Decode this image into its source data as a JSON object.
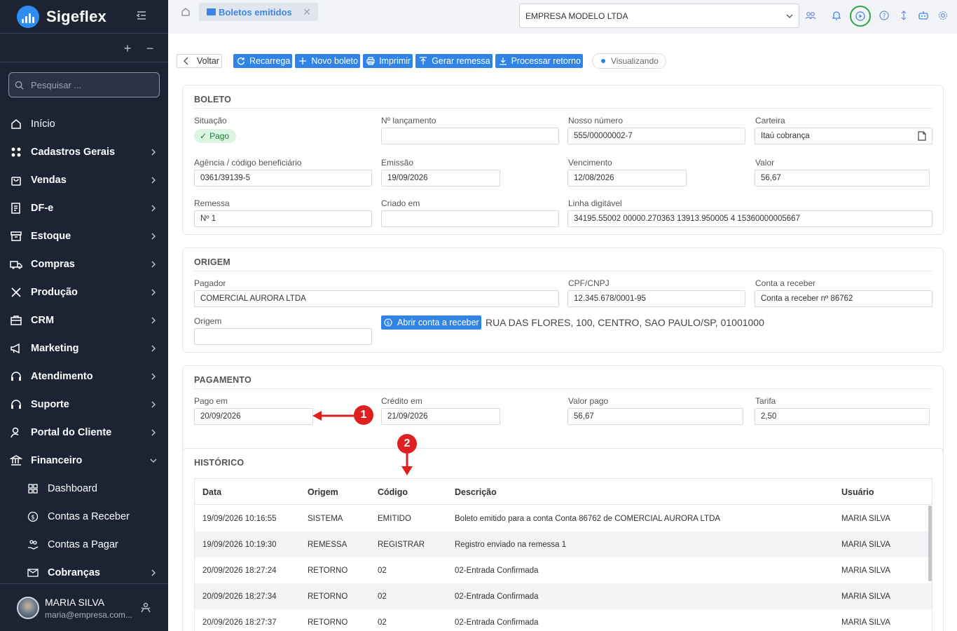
{
  "brand": {
    "name": "Sigeflex"
  },
  "sidebar": {
    "search_placeholder": "Pesquisar ...",
    "items": [
      {
        "label": "Início",
        "icon": "home-icon"
      },
      {
        "label": "Cadastros Gerais",
        "icon": "grid-icon"
      },
      {
        "label": "Vendas",
        "icon": "bag-icon"
      },
      {
        "label": "DF-e",
        "icon": "document-icon"
      },
      {
        "label": "Estoque",
        "icon": "archive-icon"
      },
      {
        "label": "Compras",
        "icon": "truck-icon"
      },
      {
        "label": "Produção",
        "icon": "tools-icon"
      },
      {
        "label": "CRM",
        "icon": "briefcase-icon"
      },
      {
        "label": "Marketing",
        "icon": "megaphone-icon"
      },
      {
        "label": "Atendimento",
        "icon": "headset-icon"
      },
      {
        "label": "Suporte",
        "icon": "headset-icon"
      },
      {
        "label": "Portal do Cliente",
        "icon": "user-icon"
      },
      {
        "label": "Financeiro",
        "icon": "bank-icon"
      }
    ],
    "financeiro_sub": [
      {
        "label": "Dashboard",
        "icon": "dashboard-icon"
      },
      {
        "label": "Contas a Receber",
        "icon": "dollar-icon"
      },
      {
        "label": "Contas a Pagar",
        "icon": "hand-coins-icon"
      },
      {
        "label": "Cobranças",
        "icon": "mail-icon"
      }
    ],
    "user": {
      "name": "MARIA SILVA",
      "email": "maria@empresa.com..."
    }
  },
  "topbar": {
    "tab_label": "Boletos emitidos",
    "company": "EMPRESA MODELO LTDA"
  },
  "toolbar": {
    "back": "Voltar",
    "reload": "Recarrega",
    "new": "Novo boleto",
    "print": "Imprimir",
    "remessa": "Gerar remessa",
    "retorno": "Processar retorno",
    "mode": "Visualizando"
  },
  "boleto": {
    "title": "BOLETO",
    "situacao_label": "Situação",
    "situacao": "Pago",
    "lancamento_label": "Nº lançamento",
    "lancamento": "",
    "nosso_numero_label": "Nosso número",
    "nosso_numero": "555/00000002-7",
    "carteira_label": "Carteira",
    "carteira": "Itaú cobrança",
    "agencia_label": "Agência / código beneficiário",
    "agencia": "0361/39139-5",
    "emissao_label": "Emissão",
    "emissao": "19/09/2026",
    "vencimento_label": "Vencimento",
    "vencimento": "12/08/2026",
    "valor_label": "Valor",
    "valor": "56,67",
    "remessa_label": "Remessa",
    "remessa": "Nº 1",
    "criado_label": "Criado em",
    "criado": "",
    "linha_label": "Linha digitável",
    "linha": "34195.55002 00000.270363 13913.950005 4 15360000005667"
  },
  "origem": {
    "title": "ORIGEM",
    "pagador_label": "Pagador",
    "pagador": "COMERCIAL AURORA LTDA",
    "cpf_label": "CPF/CNPJ",
    "cpf": "12.345.678/0001-95",
    "conta_label": "Conta a receber",
    "conta": "Conta a receber nº 86762",
    "origem_label": "Origem",
    "origem": "",
    "open_btn": "Abrir conta a receber",
    "endereco": "RUA DAS FLORES, 100, CENTRO, SAO PAULO/SP, 01001000"
  },
  "pagamento": {
    "title": "PAGAMENTO",
    "pago_label": "Pago em",
    "pago": "20/09/2026",
    "credito_label": "Crédito em",
    "credito": "21/09/2026",
    "valor_pago_label": "Valor pago",
    "valor_pago": "56,67",
    "tarifa_label": "Tarifa",
    "tarifa": "2,50"
  },
  "historico": {
    "title": "HISTÓRICO",
    "columns": [
      "Data",
      "Origem",
      "Código",
      "Descrição",
      "Usuário"
    ],
    "rows": [
      [
        "19/09/2026 10:16:55",
        "SISTEMA",
        "EMITIDO",
        "Boleto emitido para a conta Conta 86762 de COMERCIAL AURORA LTDA",
        "MARIA SILVA"
      ],
      [
        "19/09/2026 10:19:30",
        "REMESSA",
        "REGISTRAR",
        "Registro enviado na remessa 1",
        "MARIA SILVA"
      ],
      [
        "20/09/2026 18:27:24",
        "RETORNO",
        "02",
        "02-Entrada Confirmada",
        "MARIA SILVA"
      ],
      [
        "20/09/2026 18:27:34",
        "RETORNO",
        "02",
        "02-Entrada Confirmada",
        "MARIA SILVA"
      ],
      [
        "20/09/2026 18:27:37",
        "RETORNO",
        "02",
        "02-Entrada Confirmada",
        "MARIA SILVA"
      ]
    ]
  },
  "annotations": [
    {
      "label": "1"
    },
    {
      "label": "2"
    }
  ],
  "colors": {
    "sidebar": "#1c2434",
    "accent": "#2f84e6",
    "annotation": "#e02020",
    "paid": "#1e7e34"
  }
}
